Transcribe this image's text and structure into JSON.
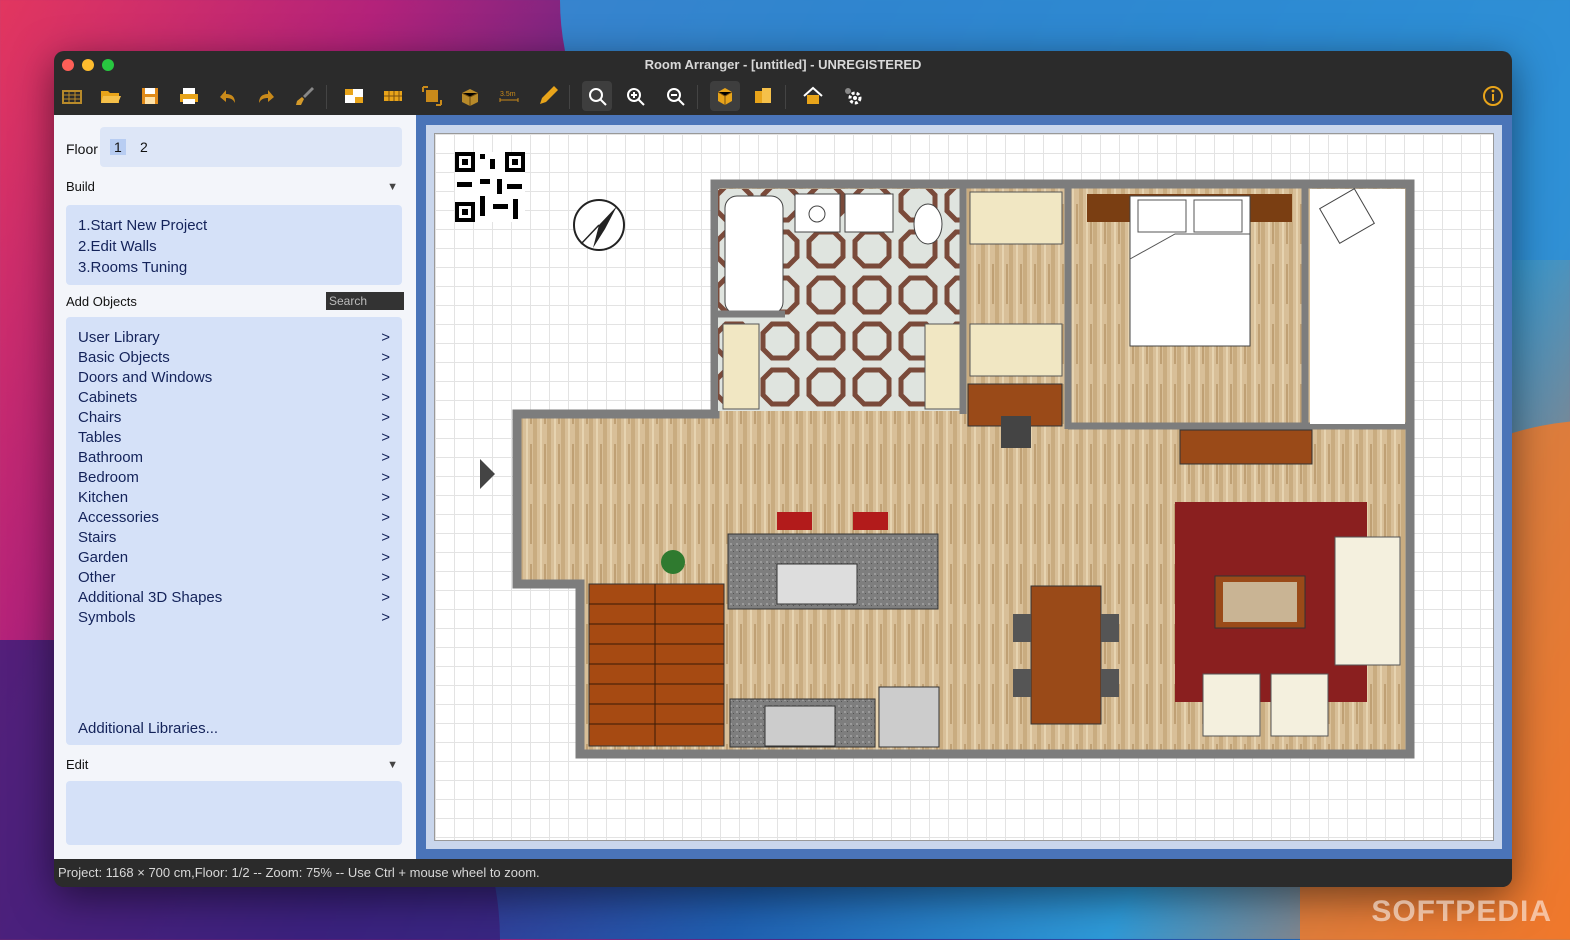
{
  "window": {
    "title": "Room Arranger - [untitled] - UNREGISTERED"
  },
  "floor": {
    "label": "Floor",
    "options": [
      "1",
      "2"
    ],
    "selected": "1"
  },
  "build": {
    "label": "Build",
    "items": [
      "1.Start New Project",
      "2.Edit Walls",
      "3.Rooms Tuning"
    ]
  },
  "add_objects": {
    "label": "Add Objects",
    "search_placeholder": "Search",
    "items": [
      "User Library",
      "Basic Objects",
      "Doors and Windows",
      "Cabinets",
      "Chairs",
      "Tables",
      "Bathroom",
      "Bedroom",
      "Kitchen",
      "Accessories",
      "Stairs",
      "Garden",
      "Other",
      "Additional 3D Shapes",
      "Symbols"
    ],
    "chevron": ">",
    "more_link": "Additional Libraries..."
  },
  "edit": {
    "label": "Edit"
  },
  "status": {
    "text": "Project: 1168 × 700 cm,Floor: 1/2 -- Zoom: 75% -- Use Ctrl + mouse wheel to zoom."
  },
  "toolbar": {
    "icons": [
      "grid-icon",
      "open-folder-icon",
      "save-icon",
      "print-icon",
      "undo-icon",
      "redo-icon",
      "brush-icon",
      "wall-icon",
      "floor-icon",
      "resize-icon",
      "object-icon",
      "measure-icon",
      "pencil-icon",
      "zoom-fit-icon",
      "zoom-in-icon",
      "zoom-out-icon",
      "3d-box-icon",
      "3d-multi-icon",
      "house-icon",
      "settings-icon",
      "info-icon"
    ],
    "measure_label": "3.5m"
  },
  "colors": {
    "accent": "#4a74b8",
    "panel": "#d5e1f8",
    "link_text": "#14235a",
    "toolbar_bg": "#2b2b2b"
  },
  "watermark": "SOFTPEDIA"
}
